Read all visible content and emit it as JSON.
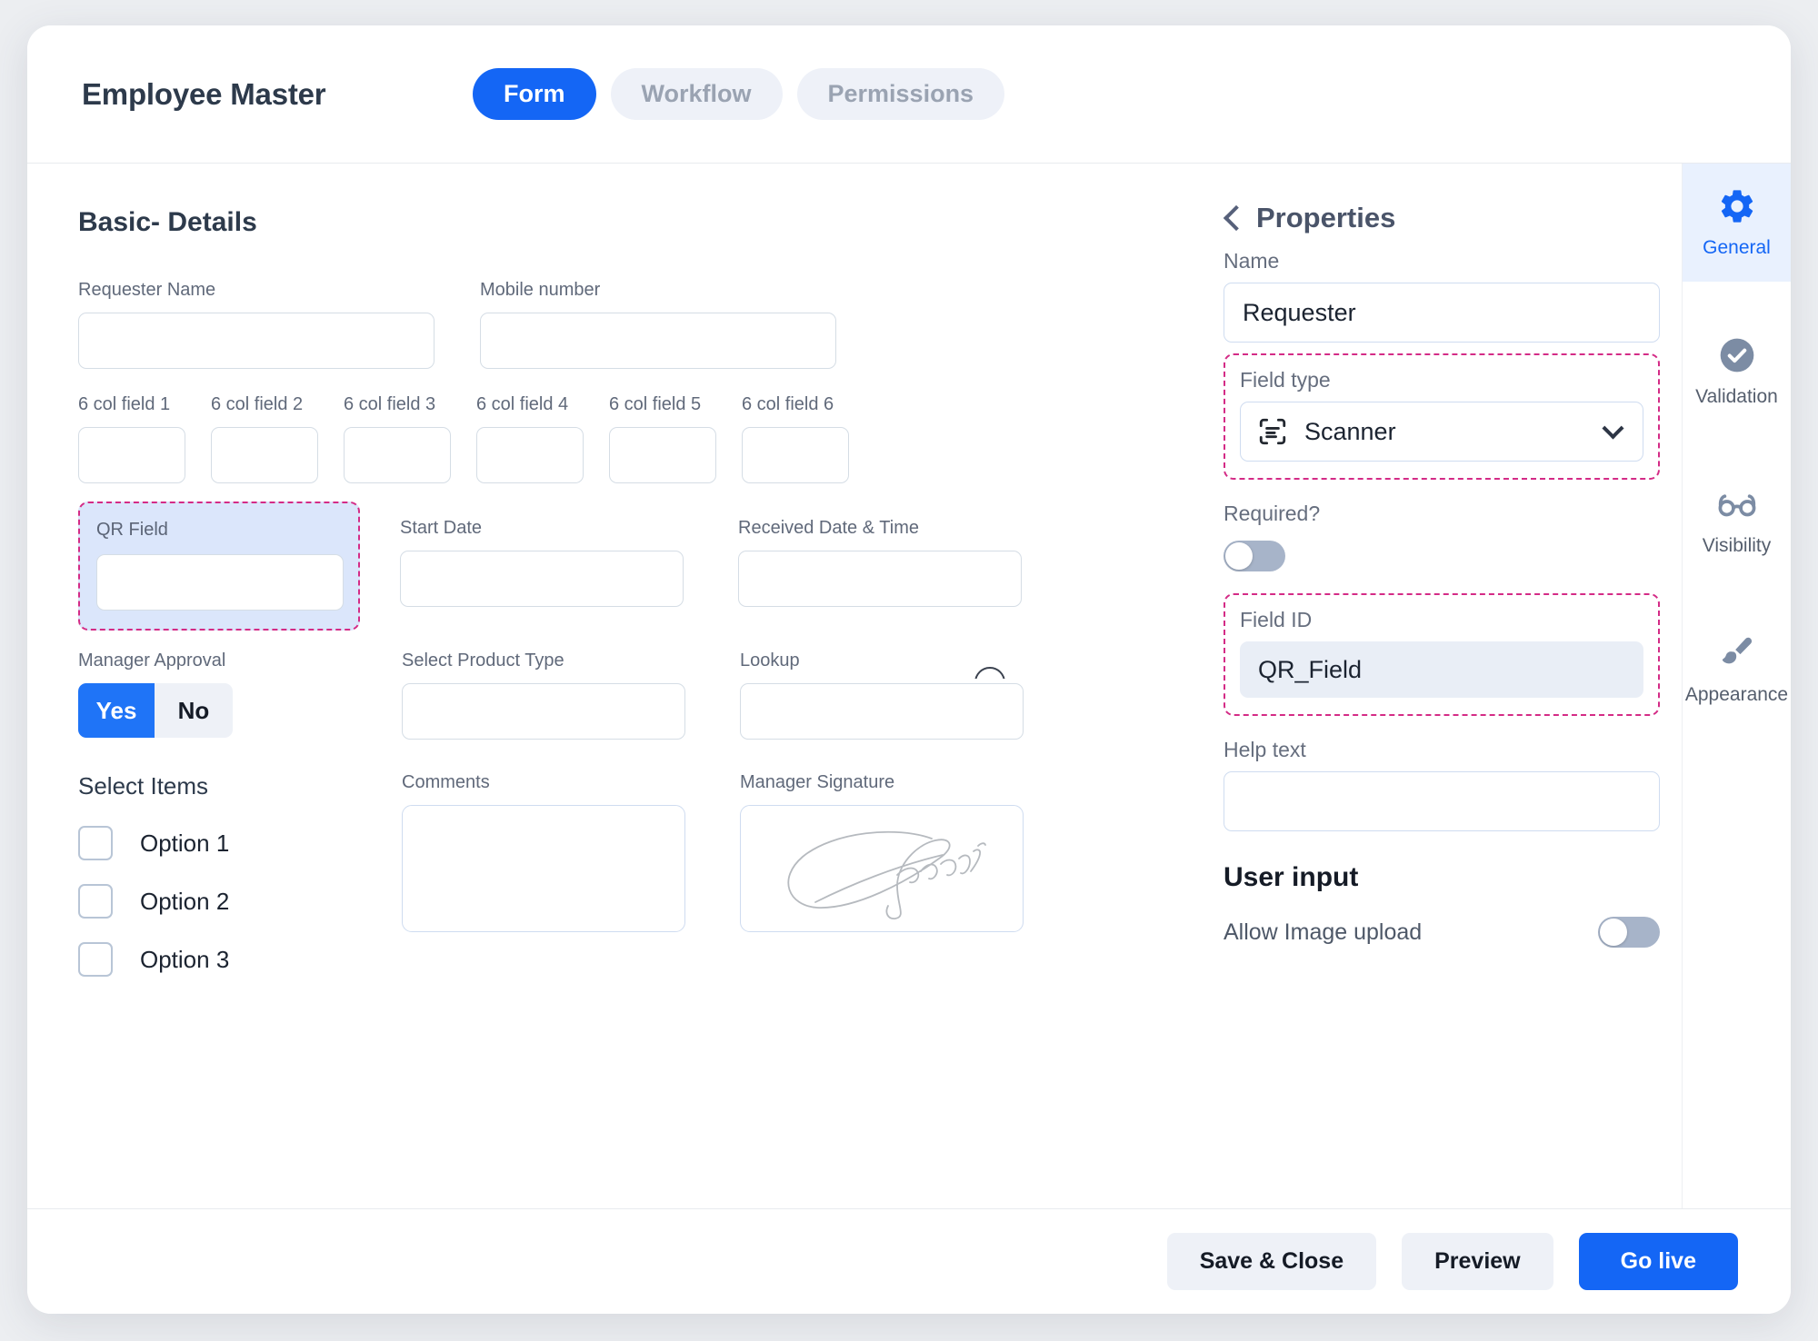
{
  "header": {
    "app_title": "Employee Master",
    "tabs": [
      {
        "label": "Form",
        "active": true
      },
      {
        "label": "Workflow",
        "active": false
      },
      {
        "label": "Permissions",
        "active": false
      }
    ]
  },
  "form": {
    "section_title": "Basic- Details",
    "row1": [
      {
        "label": "Requester Name"
      },
      {
        "label": "Mobile number"
      }
    ],
    "six_col": [
      {
        "label": "6 col field 1"
      },
      {
        "label": "6 col field 2"
      },
      {
        "label": "6 col field 3"
      },
      {
        "label": "6 col field 4"
      },
      {
        "label": "6 col field 5"
      },
      {
        "label": "6 col field 6"
      }
    ],
    "row3": {
      "qr_label": "QR Field",
      "start_date_label": "Start Date",
      "received_label": "Received Date & Time"
    },
    "row4": {
      "approval_label": "Manager Approval",
      "yes_label": "Yes",
      "no_label": "No",
      "product_label": "Select Product Type",
      "lookup_label": "Lookup"
    },
    "row5": {
      "select_items_label": "Select Items",
      "options": [
        "Option 1",
        "Option 2",
        "Option 3"
      ],
      "comments_label": "Comments",
      "signature_label": "Manager Signature"
    }
  },
  "properties": {
    "title": "Properties",
    "back_icon": "chevron-left-icon",
    "name_label": "Name",
    "name_value": "Requester",
    "field_type_label": "Field type",
    "field_type_value": "Scanner",
    "field_type_icon": "scanner-icon",
    "required_label": "Required?",
    "required_on": false,
    "field_id_label": "Field ID",
    "field_id_value": "QR_Field",
    "help_text_label": "Help text",
    "help_text_value": "",
    "user_input_heading": "User input",
    "allow_image_upload_label": "Allow Image upload",
    "allow_image_upload_on": false
  },
  "rail": [
    {
      "label": "General",
      "icon": "gear-icon",
      "active": true
    },
    {
      "label": "Validation",
      "icon": "check-circle-icon",
      "active": false
    },
    {
      "label": "Visibility",
      "icon": "glasses-icon",
      "active": false
    },
    {
      "label": "Appearance",
      "icon": "paint-brush-icon",
      "active": false
    }
  ],
  "footer": {
    "save_close": "Save  & Close",
    "preview": "Preview",
    "go_live": "Go live"
  },
  "colors": {
    "accent_blue": "#1466f5",
    "highlight_pink": "#d42b86",
    "selected_field_bg": "#dbe6fb",
    "muted_gray": "#8794a8"
  }
}
